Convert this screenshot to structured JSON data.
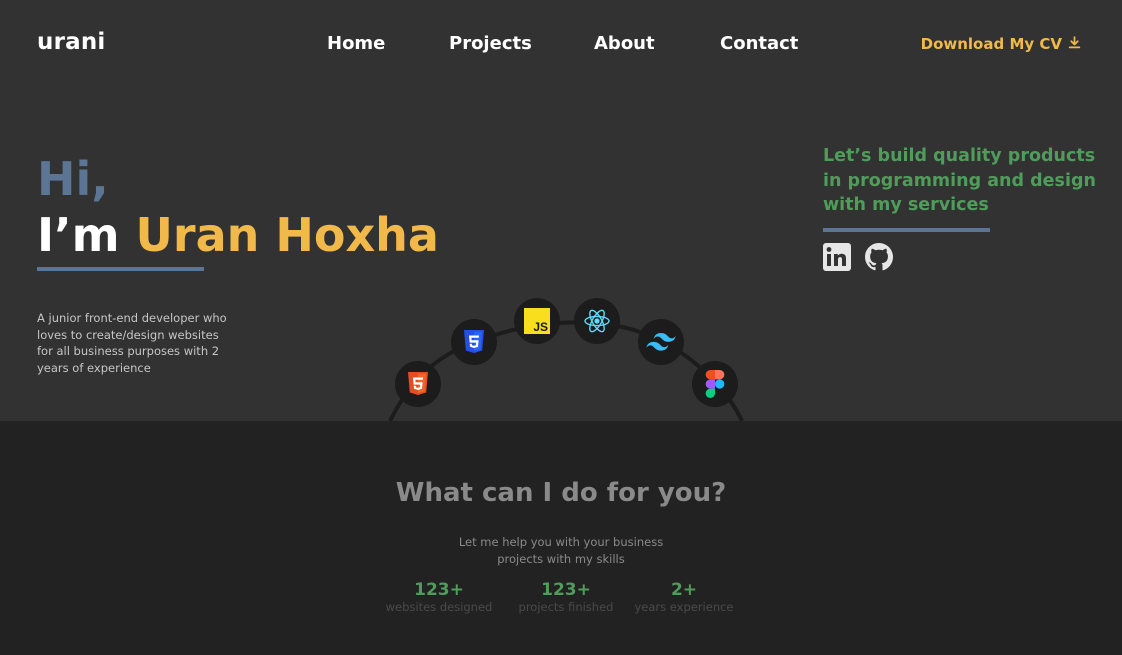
{
  "header": {
    "logo": "urani",
    "nav": [
      "Home",
      "Projects",
      "About",
      "Contact"
    ],
    "download_label": "Download My CV",
    "download_icon": "download-icon"
  },
  "hero": {
    "greeting": "Hi,",
    "im": "I’m",
    "name": "Uran Hoxha",
    "intro": "A junior front-end developer who loves to create/design websites for all business purposes with 2 years of experience",
    "tagline": "Let’s build quality products in programming and design with my services",
    "socials": [
      "linkedin-icon",
      "github-icon"
    ],
    "tech_icons": [
      "html5-icon",
      "css3-icon",
      "javascript-icon",
      "react-icon",
      "tailwind-icon",
      "figma-icon"
    ],
    "js_text": "JS"
  },
  "services": {
    "title": "What can I do for you?",
    "subtitle": "Let me help you with your business projects with my skills",
    "stats": [
      {
        "number": "123+",
        "label": "websites designed"
      },
      {
        "number": "123+",
        "label": "projects finished"
      },
      {
        "number": "2+",
        "label": "years experience"
      }
    ]
  },
  "colors": {
    "background": "#323232",
    "section_background": "#222222",
    "accent_yellow": "#f0b94a",
    "accent_blue": "#5c7594",
    "accent_green": "#4f9c5b"
  }
}
